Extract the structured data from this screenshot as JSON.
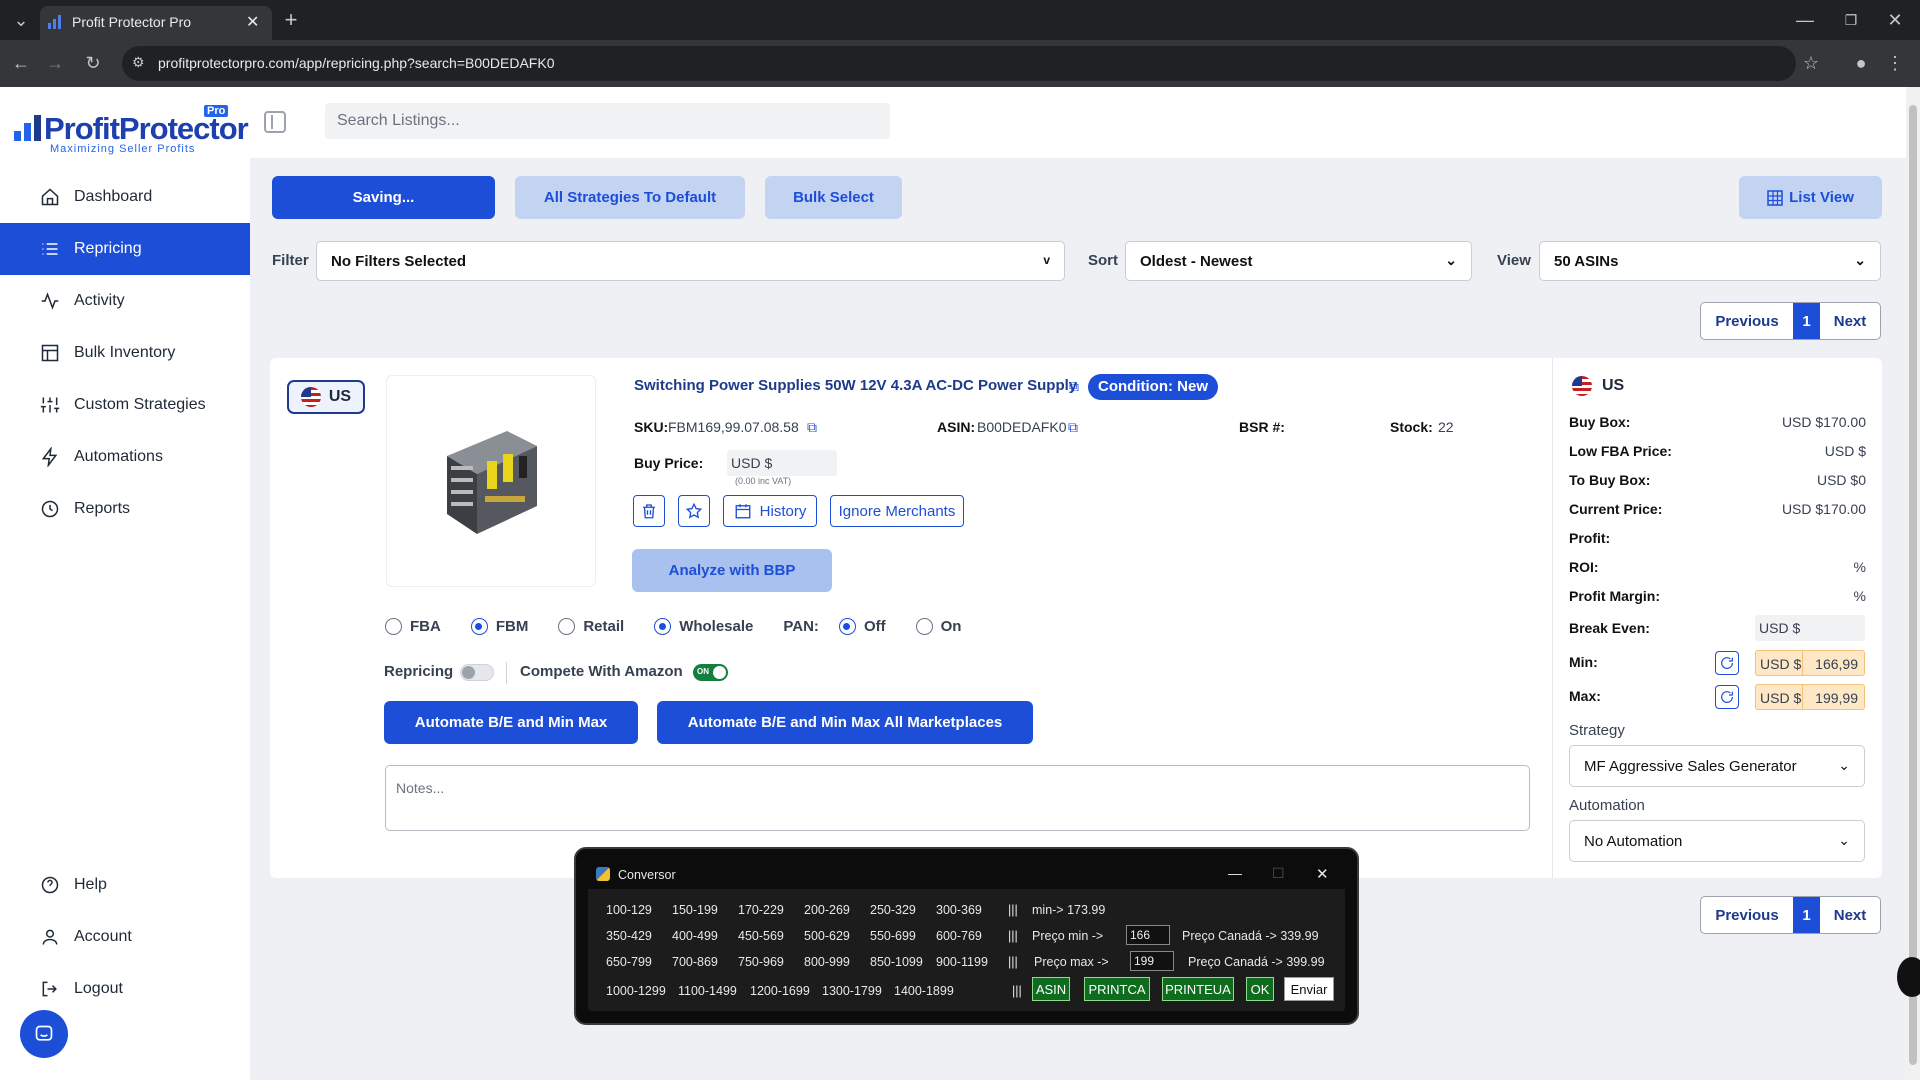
{
  "browser": {
    "tab_title": "Profit Protector Pro",
    "url": "profitprotectorpro.com/app/repricing.php?search=B00DEDAFK0"
  },
  "brand": {
    "name": "ProfitProtector",
    "badge": "Pro",
    "tagline": "Maximizing Seller Profits"
  },
  "search": {
    "placeholder": "Search Listings..."
  },
  "nav": [
    {
      "label": "Dashboard"
    },
    {
      "label": "Repricing"
    },
    {
      "label": "Activity"
    },
    {
      "label": "Bulk Inventory"
    },
    {
      "label": "Custom Strategies"
    },
    {
      "label": "Automations"
    },
    {
      "label": "Reports"
    }
  ],
  "nav_bottom": [
    {
      "label": "Help"
    },
    {
      "label": "Account"
    },
    {
      "label": "Logout"
    }
  ],
  "toolbar": {
    "saving": "Saving...",
    "all_default": "All Strategies To Default",
    "bulk_select": "Bulk Select",
    "list_view": "List View"
  },
  "filters": {
    "filter_label": "Filter",
    "filter_value": "No Filters Selected",
    "sort_label": "Sort",
    "sort_value": "Oldest - Newest",
    "view_label": "View",
    "view_value": "50 ASINs"
  },
  "pager": {
    "previous": "Previous",
    "page": "1",
    "next": "Next"
  },
  "product": {
    "marketplace": "US",
    "title": "Switching Power Supplies 50W 12V 4.3A AC-DC Power Supply",
    "condition": "Condition: New",
    "sku_label": "SKU:",
    "sku": "FBM169,99.07.08.58",
    "asin_label": "ASIN:",
    "asin": "B00DEDAFK0",
    "bsr_label": "BSR #:",
    "bsr": "",
    "stock_label": "Stock:",
    "stock": "22",
    "buy_price_label": "Buy Price:",
    "buy_price": "USD $",
    "vat_note": "(0.00 inc VAT)",
    "history": "History",
    "ignore": "Ignore Merchants",
    "analyze": "Analyze with BBP",
    "radios": {
      "fba": "FBA",
      "fbm": "FBM",
      "retail": "Retail",
      "wholesale": "Wholesale",
      "pan": "PAN:",
      "off": "Off",
      "on": "On"
    },
    "repricing_label": "Repricing",
    "compete_label": "Compete With Amazon",
    "toggle_on": "ON",
    "automate1": "Automate B/E and Min Max",
    "automate2": "Automate B/E and Min Max All Marketplaces",
    "notes_placeholder": "Notes..."
  },
  "right_panel": {
    "marketplace": "US",
    "rows": [
      {
        "k": "Buy Box:",
        "v": "USD $170.00"
      },
      {
        "k": "Low FBA Price:",
        "v": "USD $"
      },
      {
        "k": "To Buy Box:",
        "v": "USD $0"
      },
      {
        "k": "Current Price:",
        "v": "USD $170.00"
      },
      {
        "k": "Profit:",
        "v": ""
      },
      {
        "k": "ROI:",
        "v": "%"
      },
      {
        "k": "Profit Margin:",
        "v": "%"
      }
    ],
    "break_even_label": "Break Even:",
    "break_even": "USD $",
    "min_label": "Min:",
    "min_cur": "USD $",
    "min": "166,99",
    "max_label": "Max:",
    "max_cur": "USD $",
    "max": "199,99",
    "strategy_label": "Strategy",
    "strategy": "MF Aggressive Sales Generator",
    "automation_label": "Automation",
    "automation": "No Automation"
  },
  "conversor": {
    "title": "Conversor",
    "rows": [
      [
        "100-129",
        "150-199",
        "170-229",
        "200-269",
        "250-329",
        "300-369"
      ],
      [
        "350-429",
        "400-499",
        "450-569",
        "500-629",
        "550-699",
        "600-769"
      ],
      [
        "650-799",
        "700-869",
        "750-969",
        "800-999",
        "850-1099",
        "900-1199"
      ],
      [
        "1000-1299",
        "1100-1499",
        "1200-1699",
        "1300-1799",
        "1400-1899"
      ]
    ],
    "sep": "|||",
    "min_text": "min-> 173.99",
    "preco_min": "Preço min ->",
    "min_input": "166",
    "canada_min": "Preço Canadá -> 339.99",
    "preco_max": "Preço max ->",
    "max_input": "199",
    "canada_max": "Preço Canadá -> 399.99",
    "buttons": [
      "ASIN",
      "PRINTCA",
      "PRINTEUA",
      "OK"
    ],
    "send": "Enviar"
  },
  "colors": {
    "accent": "#1d4ed8",
    "light_accent": "#c3d3f2",
    "condition_badge": "#1d4ed8"
  }
}
